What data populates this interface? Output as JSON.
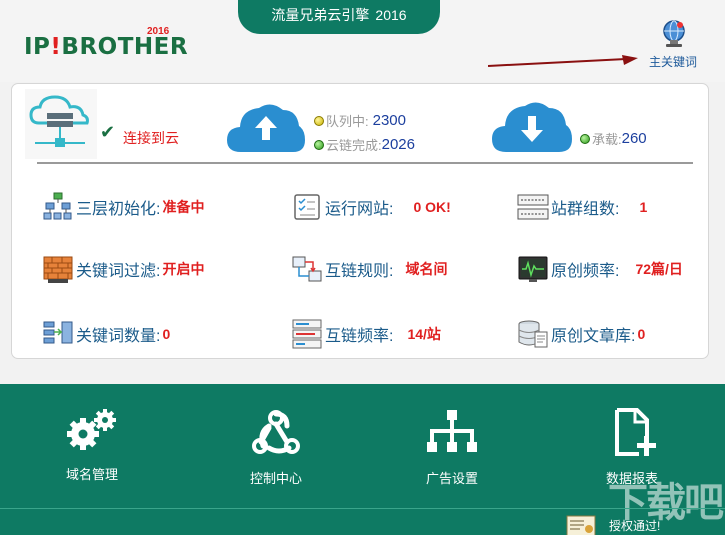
{
  "header": {
    "title": "流量兄弟云引擎",
    "year": "2016",
    "logo_prefix": "IP",
    "logo_bang": "!",
    "logo_suffix": "BROTHER",
    "logo_year": "2016",
    "keyword_link": "主关键词"
  },
  "status": {
    "connected": "连接到云",
    "queue_label": "队列中:",
    "queue_value": "2300",
    "cloudlink_label": "云链完成:",
    "cloudlink_value": "2026",
    "load_label": "承载:",
    "load_value": "260"
  },
  "items": [
    {
      "label": "三层初始化:",
      "value": "准备中"
    },
    {
      "label": "运行网站:",
      "value": "0 OK!"
    },
    {
      "label": "站群组数:",
      "value": "1"
    },
    {
      "label": "关键词过滤:",
      "value": "开启中"
    },
    {
      "label": "互链规则:",
      "value": "域名间"
    },
    {
      "label": "原创频率:",
      "value": "72篇/日"
    },
    {
      "label": "关键词数量:",
      "value": "0"
    },
    {
      "label": "互链频率:",
      "value": "14/站"
    },
    {
      "label": "原创文章库:",
      "value": "0"
    }
  ],
  "nav": [
    {
      "label": "域名管理"
    },
    {
      "label": "控制中心"
    },
    {
      "label": "广告设置"
    },
    {
      "label": "数据报表"
    }
  ],
  "footer": {
    "auth": "授权通过!",
    "watermark": "下载吧"
  },
  "colors": {
    "brand_green": "#0e7a63",
    "logo_green": "#1a6f42",
    "value_red": "#e02020",
    "label_blue": "#1b5b8a",
    "cloud_blue": "#2a8ed0"
  }
}
